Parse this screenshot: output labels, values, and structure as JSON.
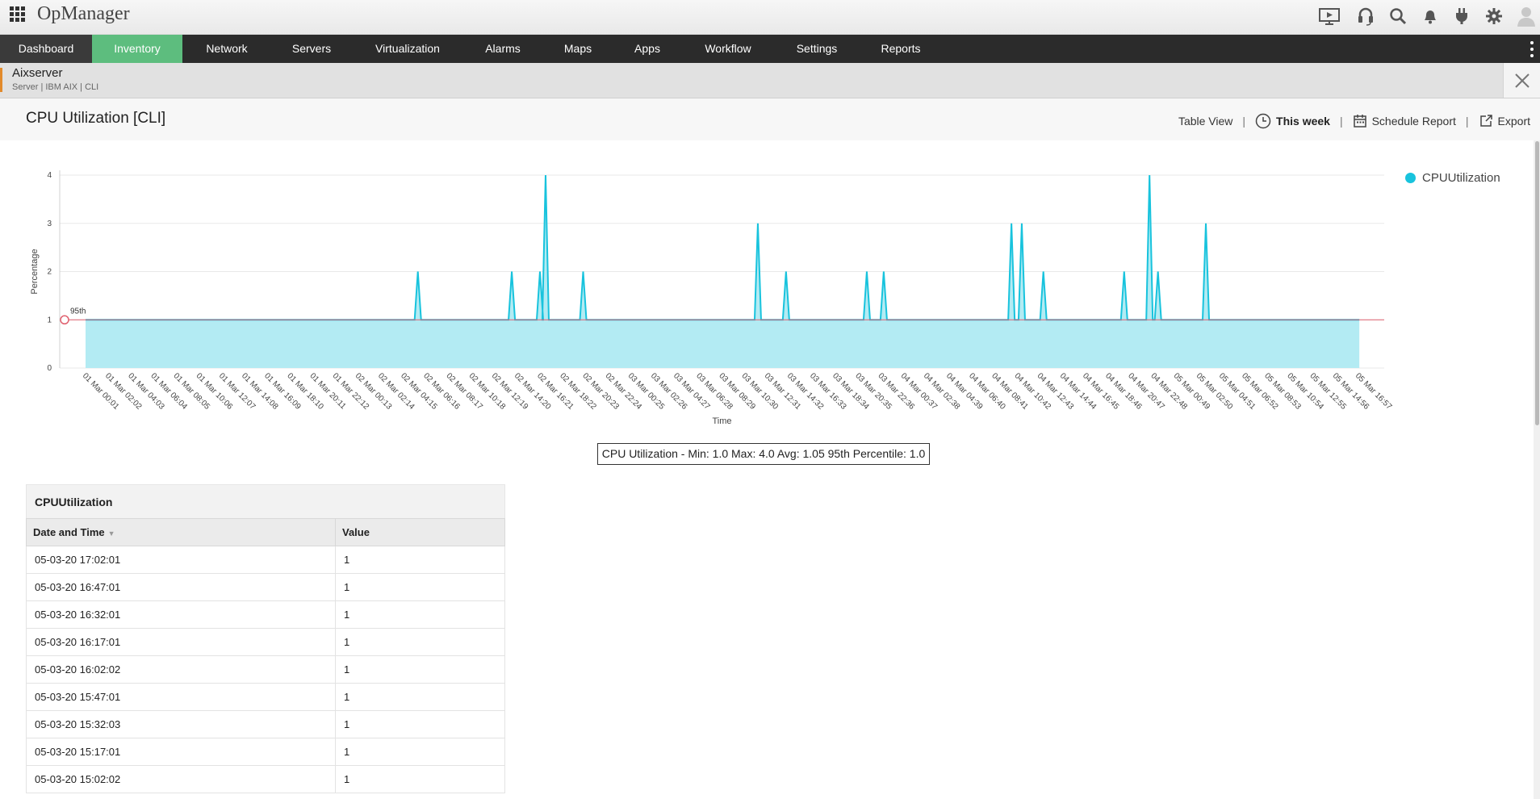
{
  "app": {
    "title": "OpManager"
  },
  "nav": {
    "items": [
      {
        "label": "Dashboard"
      },
      {
        "label": "Inventory"
      },
      {
        "label": "Network"
      },
      {
        "label": "Servers"
      },
      {
        "label": "Virtualization"
      },
      {
        "label": "Alarms"
      },
      {
        "label": "Maps"
      },
      {
        "label": "Apps"
      },
      {
        "label": "Workflow"
      },
      {
        "label": "Settings"
      },
      {
        "label": "Reports"
      }
    ],
    "active": "Inventory"
  },
  "device": {
    "name": "Aixserver",
    "meta": "Server | IBM AIX | CLI"
  },
  "page": {
    "title": "CPU Utilization [CLI]"
  },
  "toolbar": {
    "table_view": "Table View",
    "period": "This week",
    "schedule": "Schedule Report",
    "export": "Export",
    "separator": "|"
  },
  "colors": {
    "accent": "#5dbd7e",
    "series": "#18c3dd",
    "fill": "#b3ebf3",
    "percentile": "#e0606e"
  },
  "chart_data": {
    "type": "area",
    "ylabel": "Percentage",
    "xlabel": "Time",
    "ylim": [
      0,
      4
    ],
    "yticks": [
      "0",
      "1",
      "2",
      "3",
      "4"
    ],
    "grid": true,
    "legend": "top-right",
    "percentile_label": "95th",
    "percentile_value": 1.0,
    "xticks": [
      "01 Mar 00:01",
      "01 Mar 02:02",
      "01 Mar 04:03",
      "01 Mar 06:04",
      "01 Mar 08:05",
      "01 Mar 10:06",
      "01 Mar 12:07",
      "01 Mar 14:08",
      "01 Mar 16:09",
      "01 Mar 18:10",
      "01 Mar 20:11",
      "01 Mar 22:12",
      "02 Mar 00:13",
      "02 Mar 02:14",
      "02 Mar 04:15",
      "02 Mar 06:16",
      "02 Mar 08:17",
      "02 Mar 10:18",
      "02 Mar 12:19",
      "02 Mar 14:20",
      "02 Mar 16:21",
      "02 Mar 18:22",
      "02 Mar 20:23",
      "02 Mar 22:24",
      "03 Mar 00:25",
      "03 Mar 02:26",
      "03 Mar 04:27",
      "03 Mar 06:28",
      "03 Mar 08:29",
      "03 Mar 10:30",
      "03 Mar 12:31",
      "03 Mar 14:32",
      "03 Mar 16:33",
      "03 Mar 18:34",
      "03 Mar 20:35",
      "03 Mar 22:36",
      "04 Mar 00:37",
      "04 Mar 02:38",
      "04 Mar 04:39",
      "04 Mar 06:40",
      "04 Mar 08:41",
      "04 Mar 10:42",
      "04 Mar 12:43",
      "04 Mar 14:44",
      "04 Mar 16:45",
      "04 Mar 18:46",
      "04 Mar 20:47",
      "04 Mar 22:48",
      "05 Mar 00:49",
      "05 Mar 02:50",
      "05 Mar 04:51",
      "05 Mar 06:52",
      "05 Mar 08:53",
      "05 Mar 10:54",
      "05 Mar 12:55",
      "05 Mar 14:56",
      "05 Mar 16:57"
    ],
    "series": [
      {
        "name": "CPUUtilization",
        "baseline": 1,
        "points": [
          {
            "x": "01 Mar 00:01",
            "y": 1
          },
          {
            "x": "02 Mar 05:30",
            "y": 2
          },
          {
            "x": "02 Mar 13:50",
            "y": 2
          },
          {
            "x": "02 Mar 16:20",
            "y": 2
          },
          {
            "x": "02 Mar 16:50",
            "y": 4
          },
          {
            "x": "02 Mar 20:10",
            "y": 2
          },
          {
            "x": "03 Mar 11:40",
            "y": 3
          },
          {
            "x": "03 Mar 14:10",
            "y": 2
          },
          {
            "x": "03 Mar 21:20",
            "y": 2
          },
          {
            "x": "03 Mar 22:50",
            "y": 2
          },
          {
            "x": "04 Mar 10:10",
            "y": 3
          },
          {
            "x": "04 Mar 11:05",
            "y": 3
          },
          {
            "x": "04 Mar 13:00",
            "y": 2
          },
          {
            "x": "04 Mar 20:10",
            "y": 2
          },
          {
            "x": "04 Mar 22:25",
            "y": 4
          },
          {
            "x": "04 Mar 23:10",
            "y": 2
          },
          {
            "x": "05 Mar 03:25",
            "y": 3
          },
          {
            "x": "05 Mar 17:02",
            "y": 1
          }
        ]
      }
    ]
  },
  "summary": "CPU Utilization - Min: 1.0 Max: 4.0 Avg: 1.05 95th Percentile: 1.0",
  "table": {
    "title": "CPUUtilization",
    "headers": {
      "datetime": "Date and Time",
      "value": "Value"
    },
    "rows": [
      {
        "datetime": "05-03-20 17:02:01",
        "value": "1"
      },
      {
        "datetime": "05-03-20 16:47:01",
        "value": "1"
      },
      {
        "datetime": "05-03-20 16:32:01",
        "value": "1"
      },
      {
        "datetime": "05-03-20 16:17:01",
        "value": "1"
      },
      {
        "datetime": "05-03-20 16:02:02",
        "value": "1"
      },
      {
        "datetime": "05-03-20 15:47:01",
        "value": "1"
      },
      {
        "datetime": "05-03-20 15:32:03",
        "value": "1"
      },
      {
        "datetime": "05-03-20 15:17:01",
        "value": "1"
      },
      {
        "datetime": "05-03-20 15:02:02",
        "value": "1"
      }
    ]
  }
}
